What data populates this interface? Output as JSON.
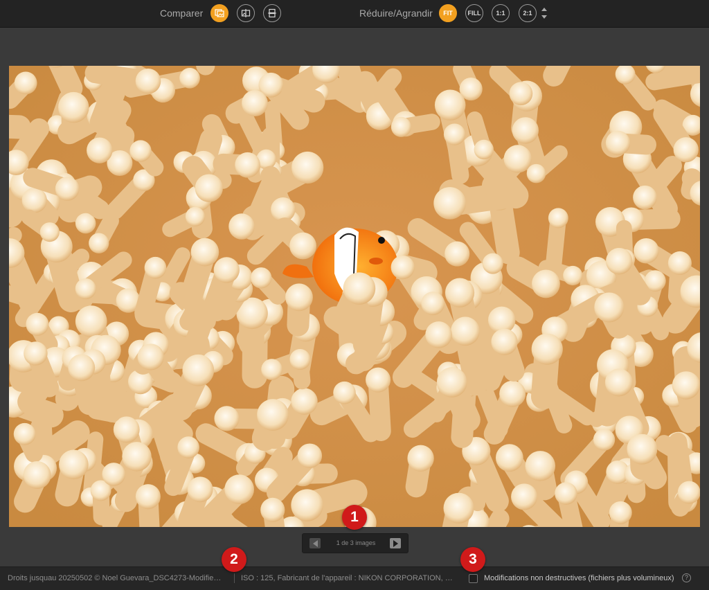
{
  "toolbar": {
    "compare_label": "Comparer",
    "resize_label": "Réduire/Agrandir",
    "zoom_buttons": [
      "FIT",
      "FILL",
      "1:1",
      "2:1"
    ],
    "accent_color": "#f2a020"
  },
  "pager": {
    "text": "1 de 3 images"
  },
  "statusbar": {
    "file_info": "Droits jusquau 20250502 © Noel Guevara_DSC4273-Modifie…",
    "camera_info": "ISO : 125, Fabricant de l'appareil : NIKON CORPORATION, …",
    "nondestructive_label": "Modifications non destructives (fichiers plus volumineux)",
    "help_glyph": "?"
  },
  "badges": [
    "1",
    "2",
    "3"
  ],
  "icons": {
    "compare_1": "photo-compare-icon",
    "compare_2": "split-compare-icon",
    "compare_3": "stack-compare-icon"
  }
}
